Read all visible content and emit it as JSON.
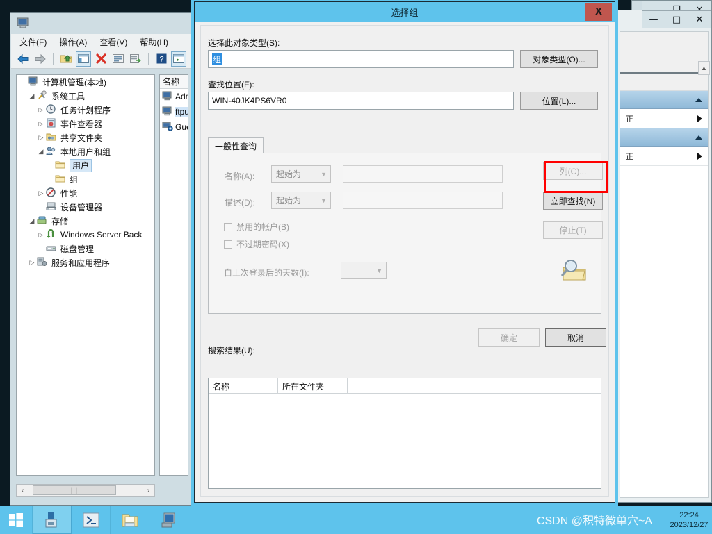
{
  "desktop": {
    "taskbar": {
      "start_label": "start-button",
      "apps": [
        "server-manager-icon",
        "powershell-icon",
        "file-explorer-icon",
        "computer-management-icon"
      ],
      "clock_time": "22:24",
      "clock_date": "2023/12/27",
      "watermark": "CSDN @积特微单穴~A"
    },
    "background_color": "#5ec3ec"
  },
  "computer_management": {
    "window_icon": "computer-management-icon",
    "menu": [
      {
        "label": "文件(F)"
      },
      {
        "label": "操作(A)"
      },
      {
        "label": "查看(V)"
      },
      {
        "label": "帮助(H)"
      }
    ],
    "toolbar": [
      {
        "name": "back-arrow-icon",
        "glyph": "←"
      },
      {
        "name": "forward-arrow-icon",
        "glyph": "→"
      },
      {
        "name": "up-folder-icon",
        "glyph": "🗁"
      },
      {
        "name": "show-tree-icon",
        "glyph": "▤"
      },
      {
        "name": "delete-icon",
        "glyph": "✕"
      },
      {
        "name": "properties-icon",
        "glyph": "▤"
      },
      {
        "name": "export-list-icon",
        "glyph": "▥"
      },
      {
        "name": "help-icon",
        "glyph": "?"
      },
      {
        "name": "show-action-pane-icon",
        "glyph": "▤"
      }
    ],
    "tree": [
      {
        "label": "计算机管理(本地)",
        "depth": 0,
        "expander": "",
        "icon": "computer-icon",
        "selected": false
      },
      {
        "label": "系统工具",
        "depth": 1,
        "expander": "open",
        "icon": "tools-icon",
        "selected": false
      },
      {
        "label": "任务计划程序",
        "depth": 2,
        "expander": "closed",
        "icon": "clock-icon",
        "selected": false
      },
      {
        "label": "事件查看器",
        "depth": 2,
        "expander": "closed",
        "icon": "event-icon",
        "selected": false
      },
      {
        "label": "共享文件夹",
        "depth": 2,
        "expander": "closed",
        "icon": "shared-folder-icon",
        "selected": false
      },
      {
        "label": "本地用户和组",
        "depth": 2,
        "expander": "open",
        "icon": "users-icon",
        "selected": false
      },
      {
        "label": "用户",
        "depth": 3,
        "expander": "",
        "icon": "folder-icon",
        "selected": true
      },
      {
        "label": "组",
        "depth": 3,
        "expander": "",
        "icon": "folder-icon",
        "selected": false
      },
      {
        "label": "性能",
        "depth": 2,
        "expander": "closed",
        "icon": "performance-icon",
        "selected": false
      },
      {
        "label": "设备管理器",
        "depth": 2,
        "expander": "",
        "icon": "device-manager-icon",
        "selected": false
      },
      {
        "label": "存储",
        "depth": 1,
        "expander": "open",
        "icon": "storage-icon",
        "selected": false
      },
      {
        "label": "Windows Server Back",
        "depth": 2,
        "expander": "closed",
        "icon": "backup-icon",
        "selected": false
      },
      {
        "label": "磁盘管理",
        "depth": 2,
        "expander": "",
        "icon": "disk-icon",
        "selected": false
      },
      {
        "label": "服务和应用程序",
        "depth": 1,
        "expander": "closed",
        "icon": "services-icon",
        "selected": false
      }
    ],
    "list": {
      "column_header": "名称",
      "rows": [
        {
          "name": "Adm",
          "icon": "user-icon",
          "selected": false
        },
        {
          "name": "ftpu",
          "icon": "user-icon",
          "selected": true
        },
        {
          "name": "Gue",
          "icon": "user-disabled-icon",
          "selected": false
        }
      ]
    },
    "hscroll": {
      "left_glyph": "‹",
      "right_glyph": "›",
      "thumb_grip": "|||"
    }
  },
  "background_windows": {
    "far": {
      "minimize": "—",
      "restore": "❐",
      "close": "✕"
    },
    "near": {
      "minimize": "—",
      "maximize": "□",
      "close": "✕"
    },
    "action_items": [
      {
        "type": "header",
        "label": ""
      },
      {
        "type": "row",
        "label": "正"
      },
      {
        "type": "header",
        "label": ""
      },
      {
        "type": "row",
        "label": "正"
      }
    ],
    "scroll_up_glyph": "▲"
  },
  "dialog": {
    "title": "选择组",
    "close_glyph": "X",
    "object_type": {
      "label": "选择此对象类型(S):",
      "value": "组",
      "button": "对象类型(O)..."
    },
    "location": {
      "label": "查找位置(F):",
      "value": "WIN-40JK4PS6VR0",
      "button": "位置(L)..."
    },
    "tabs": [
      {
        "label": "一般性查询",
        "active": true
      }
    ],
    "query": {
      "name_label": "名称(A):",
      "name_operator": "起始为",
      "name_value": "",
      "desc_label": "描述(D):",
      "desc_operator": "起始为",
      "desc_value": "",
      "disabled_accounts": "禁用的帐户(B)",
      "non_expiring_password": "不过期密码(X)",
      "days_since_login_label": "自上次登录后的天数(I):",
      "days_since_login_value": ""
    },
    "side_buttons": [
      {
        "label": "列(C)...",
        "name": "columns-button",
        "disabled": true,
        "highlighted": false
      },
      {
        "label": "立即查找(N)",
        "name": "find-now-button",
        "disabled": false,
        "highlighted": true
      },
      {
        "label": "停止(T)",
        "name": "stop-button",
        "disabled": true,
        "highlighted": false
      }
    ],
    "search_icon": "magnifier-folder-icon",
    "ok_button": {
      "label": "确定",
      "disabled": true
    },
    "cancel_button": {
      "label": "取消",
      "disabled": false
    },
    "results": {
      "label": "搜索结果(U):",
      "columns": [
        "名称",
        "所在文件夹"
      ],
      "rows": []
    },
    "highlight_color": "#ff0000",
    "titlebar_color": "#5ec3ec"
  }
}
